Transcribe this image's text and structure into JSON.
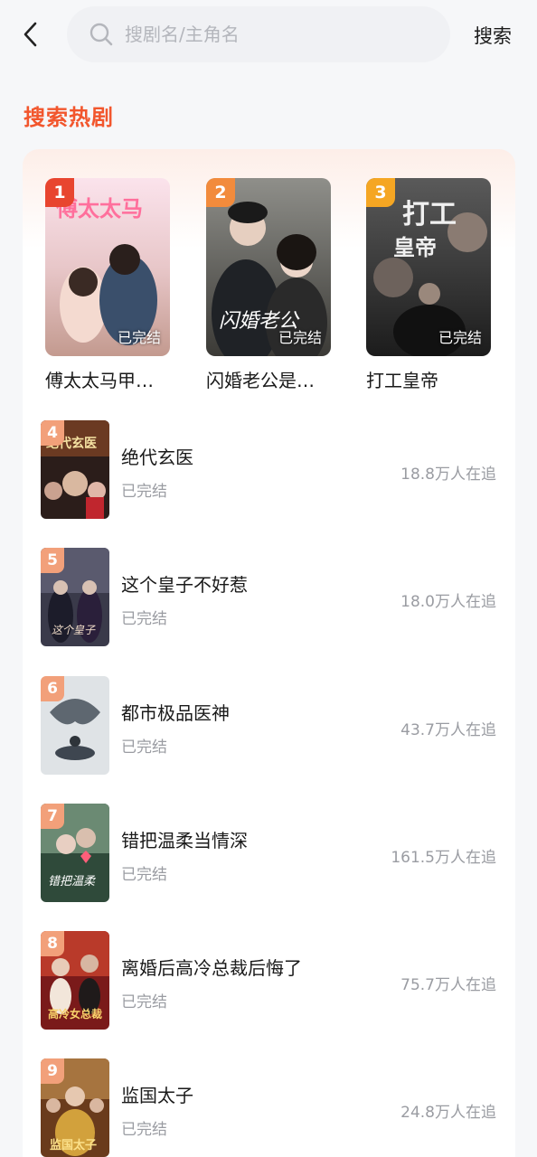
{
  "header": {
    "search_placeholder": "搜剧名/主角名",
    "search_button": "搜索"
  },
  "section": {
    "title": "搜索热剧"
  },
  "colors": {
    "accent": "#f2562d",
    "rank1": "#e8452f",
    "rank2": "#f28b3c",
    "rank3": "#f5a623",
    "rank_other": "#f2a07a"
  },
  "top3": [
    {
      "rank": "1",
      "title": "傅太太马甲…",
      "status": "已完结"
    },
    {
      "rank": "2",
      "title": "闪婚老公是…",
      "status": "已完结"
    },
    {
      "rank": "3",
      "title": "打工皇帝",
      "status": "已完结"
    }
  ],
  "list": [
    {
      "rank": "4",
      "title": "绝代玄医",
      "status": "已完结",
      "count": "18.8万人在追"
    },
    {
      "rank": "5",
      "title": "这个皇子不好惹",
      "status": "已完结",
      "count": "18.0万人在追"
    },
    {
      "rank": "6",
      "title": "都市极品医神",
      "status": "已完结",
      "count": "43.7万人在追"
    },
    {
      "rank": "7",
      "title": "错把温柔当情深",
      "status": "已完结",
      "count": "161.5万人在追"
    },
    {
      "rank": "8",
      "title": "离婚后高冷总裁后悔了",
      "status": "已完结",
      "count": "75.7万人在追"
    },
    {
      "rank": "9",
      "title": "监国太子",
      "status": "已完结",
      "count": "24.8万人在追"
    }
  ]
}
